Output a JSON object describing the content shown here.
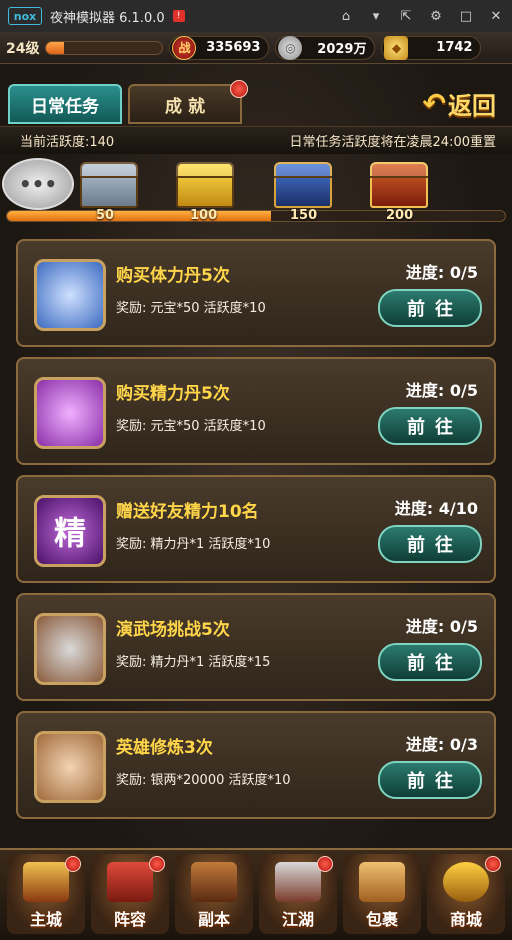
{
  "titlebar": {
    "logo": "nox",
    "title": "夜神模拟器 6.1.0.0",
    "badge": "!",
    "controls": [
      "menu-icon",
      "minimize-window-icon",
      "pin-icon",
      "settings-icon",
      "restore-icon",
      "close-icon"
    ]
  },
  "resources": {
    "level": "24级",
    "exp_progress": 0.15,
    "power_icon_text": "战",
    "power": "335693",
    "silver": "2029万",
    "gold": "1742"
  },
  "tabs": [
    {
      "label": "日常任务",
      "active": true
    },
    {
      "label": "成 就",
      "active": false,
      "badge": true
    }
  ],
  "back_label": "返回",
  "activity": {
    "current": "当前活跃度:140",
    "reset_note": "日常任务活跃度将在凌晨24:00重置",
    "progress": 0.53,
    "milestones": [
      "50",
      "100",
      "150",
      "200"
    ]
  },
  "chat_icon_text": "•••",
  "tasks": [
    {
      "icon": "blue-bottle-icon",
      "title": "购买体力丹5次",
      "reward": "奖励: 元宝*50  活跃度*10",
      "progress": "进度: 0/5",
      "button": "前往"
    },
    {
      "icon": "purple-bottle-icon",
      "title": "购买精力丹5次",
      "reward": "奖励: 元宝*50  活跃度*10",
      "progress": "进度: 0/5",
      "button": "前往"
    },
    {
      "icon": "jing-icon",
      "icon_text": "精",
      "title": "赠送好友精力10名",
      "reward": "奖励: 精力丹*1  活跃度*10",
      "progress": "进度: 4/10",
      "button": "前往"
    },
    {
      "icon": "crossed-swords-icon",
      "title": "演武场挑战5次",
      "reward": "奖励: 精力丹*1  活跃度*15",
      "progress": "进度: 0/5",
      "button": "前往"
    },
    {
      "icon": "hero-portrait-icon",
      "title": "英雄修炼3次",
      "reward": "奖励: 银两*20000  活跃度*10",
      "progress": "进度: 0/3",
      "button": "前往"
    }
  ],
  "nav": [
    {
      "label": "主城",
      "badge": true
    },
    {
      "label": "阵容",
      "badge": true
    },
    {
      "label": "副本",
      "badge": false
    },
    {
      "label": "江湖",
      "badge": true
    },
    {
      "label": "包裹",
      "badge": false
    },
    {
      "label": "商城",
      "badge": true
    }
  ]
}
